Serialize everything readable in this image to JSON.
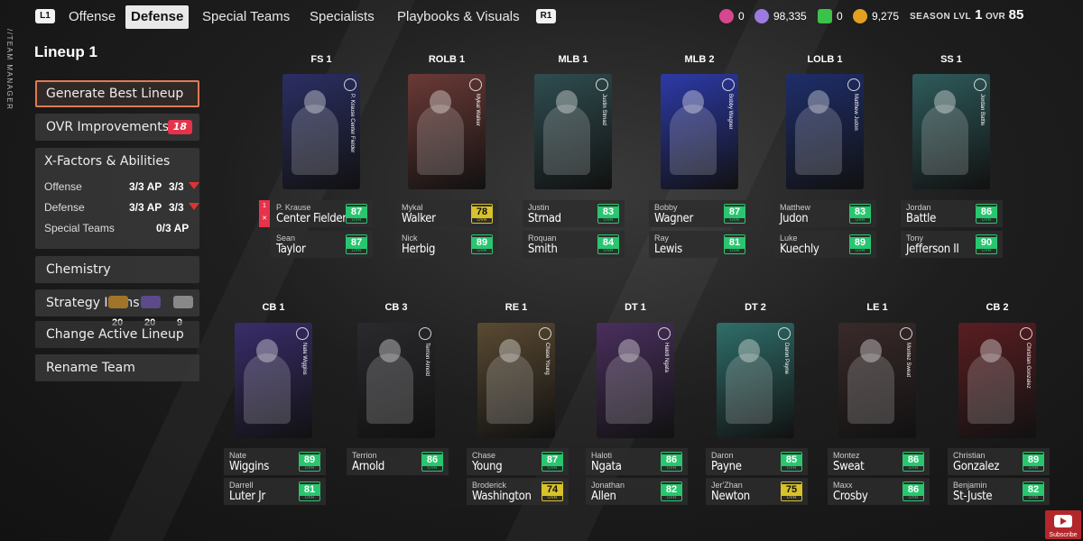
{
  "nav": {
    "l1": "L1",
    "r1": "R1",
    "tabs": [
      "Offense",
      "Defense",
      "Special Teams",
      "Specialists",
      "Playbooks & Visuals"
    ],
    "active_tab": "Defense"
  },
  "currencies": [
    {
      "icon": "tokens-icon",
      "value": "0",
      "color": "#d6478f"
    },
    {
      "icon": "ut-coins-icon",
      "value": "98,335",
      "color": "#9b7be0"
    },
    {
      "icon": "points-icon",
      "value": "0",
      "color": "#3cc14a"
    },
    {
      "icon": "training-icon",
      "value": "9,275",
      "color": "#e3a020"
    }
  ],
  "season": {
    "label": "SEASON LVL",
    "value": "1"
  },
  "team_ovr": {
    "label": "OVR",
    "value": "85"
  },
  "side_label": "//TEAM MANAGER",
  "lineup_title": "Lineup 1",
  "menu": {
    "generate": "Generate Best Lineup",
    "ovr_improvements": "OVR Improvements",
    "ovr_improvements_count": "18",
    "xfactors_title": "X-Factors & Abilities",
    "xfactors": [
      {
        "label": "Offense",
        "ap": "3/3 AP",
        "ap2": "3/3"
      },
      {
        "label": "Defense",
        "ap": "3/3 AP",
        "ap2": "3/3"
      },
      {
        "label": "Special Teams",
        "ap": "0/3 AP",
        "ap2": ""
      }
    ],
    "chemistry": "Chemistry",
    "strategy_items": "Strategy Items",
    "strategy_counts": [
      "20",
      "20",
      "9"
    ],
    "change_lineup": "Change Active Lineup",
    "rename_team": "Rename Team"
  },
  "top_row": [
    {
      "pos": "FS 1",
      "card_name": "P. Krause Center Fielder",
      "card_color": "#2b2f63",
      "starter": {
        "first": "P. Krause",
        "last": "Center Fielder",
        "ovr": "87"
      },
      "backup": {
        "first": "Sean",
        "last": "Taylor",
        "ovr": "87"
      }
    },
    {
      "pos": "ROLB 1",
      "card_name": "Mykal Walker",
      "card_color": "#6b3a36",
      "starter": {
        "first": "Mykal",
        "last": "Walker",
        "ovr": "78"
      },
      "backup": {
        "first": "Nick",
        "last": "Herbig",
        "ovr": "89"
      }
    },
    {
      "pos": "MLB 1",
      "card_name": "Justin Strnad",
      "card_color": "#2f4d50",
      "starter": {
        "first": "Justin",
        "last": "Strnad",
        "ovr": "83"
      },
      "backup": {
        "first": "Roquan",
        "last": "Smith",
        "ovr": "84"
      }
    },
    {
      "pos": "MLB 2",
      "card_name": "Bobby Wagner",
      "card_color": "#2d3aa8",
      "starter": {
        "first": "Bobby",
        "last": "Wagner",
        "ovr": "87"
      },
      "backup": {
        "first": "Ray",
        "last": "Lewis",
        "ovr": "81"
      }
    },
    {
      "pos": "LOLB 1",
      "card_name": "Matthew Judon",
      "card_color": "#1f2e6b",
      "starter": {
        "first": "Matthew",
        "last": "Judon",
        "ovr": "83"
      },
      "backup": {
        "first": "Luke",
        "last": "Kuechly",
        "ovr": "89"
      }
    },
    {
      "pos": "SS 1",
      "card_name": "Jordan Battle",
      "card_color": "#2f5b5b",
      "starter": {
        "first": "Jordan",
        "last": "Battle",
        "ovr": "86"
      },
      "backup": {
        "first": "Tony",
        "last": "Jefferson II",
        "ovr": "90"
      }
    }
  ],
  "bottom_row": [
    {
      "pos": "CB 1",
      "card_name": "Nate Wiggins",
      "card_color": "#3a2d6b",
      "starter": {
        "first": "Nate",
        "last": "Wiggins",
        "ovr": "89"
      },
      "backup": {
        "first": "Darrell",
        "last": "Luter Jr",
        "ovr": "81"
      }
    },
    {
      "pos": "CB 3",
      "card_name": "Terrion Arnold",
      "card_color": "#2a2a2e",
      "starter": {
        "first": "Terrion",
        "last": "Arnold",
        "ovr": "86"
      },
      "backup": null
    },
    {
      "pos": "RE 1",
      "card_name": "Chase Young",
      "card_color": "#5a4a32",
      "starter": {
        "first": "Chase",
        "last": "Young",
        "ovr": "87"
      },
      "backup": {
        "first": "Broderick",
        "last": "Washington",
        "ovr": "74"
      }
    },
    {
      "pos": "DT 1",
      "card_name": "Haloti Ngata",
      "card_color": "#4a2f5e",
      "starter": {
        "first": "Haloti",
        "last": "Ngata",
        "ovr": "86"
      },
      "backup": {
        "first": "Jonathan",
        "last": "Allen",
        "ovr": "82"
      }
    },
    {
      "pos": "DT 2",
      "card_name": "Daron Payne",
      "card_color": "#2f6e6a",
      "starter": {
        "first": "Daron",
        "last": "Payne",
        "ovr": "85"
      },
      "backup": {
        "first": "Jer'Zhan",
        "last": "Newton",
        "ovr": "75"
      }
    },
    {
      "pos": "LE 1",
      "card_name": "Montez Sweat",
      "card_color": "#3a2a2a",
      "starter": {
        "first": "Montez",
        "last": "Sweat",
        "ovr": "86"
      },
      "backup": {
        "first": "Maxx",
        "last": "Crosby",
        "ovr": "86"
      }
    },
    {
      "pos": "CB 2",
      "card_name": "Christian Gonzalez",
      "card_color": "#5a1e22",
      "starter": {
        "first": "Christian",
        "last": "Gonzalez",
        "ovr": "89"
      },
      "backup": {
        "first": "Benjamin",
        "last": "St-Juste",
        "ovr": "82"
      }
    }
  ],
  "subscribe": "Subscribe"
}
